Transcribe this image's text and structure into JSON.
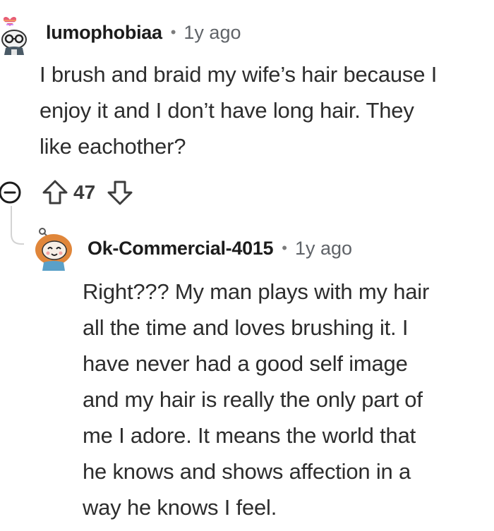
{
  "comments": [
    {
      "username": "lumophobiaa",
      "separator": "•",
      "age": "1y ago",
      "avatar_icon": "snoo-avatar-icon",
      "body": "I brush and braid my wife’s hair because I\nenjoy it and I don’t have long hair. They\nlike eachother?",
      "votes": "47"
    },
    {
      "username": "Ok-Commercial-4015",
      "separator": "•",
      "age": "1y ago",
      "avatar_icon": "snoo-avatar-icon",
      "body": "Right??? My man plays with my hair\nall the time and loves brushing it. I\nhave never had a good self image\nand my hair is really the only part of\nme I adore. It means the world that\nhe knows and shows affection in a\nway he knows I feel."
    }
  ],
  "icons": {
    "collapse": "collapse-icon",
    "upvote": "upvote-icon",
    "downvote": "downvote-icon"
  },
  "colors": {
    "text": "#2d2d2d",
    "meta": "#5f6368",
    "icon": "#3c3c3c",
    "thread_line": "#d3d3d3"
  }
}
